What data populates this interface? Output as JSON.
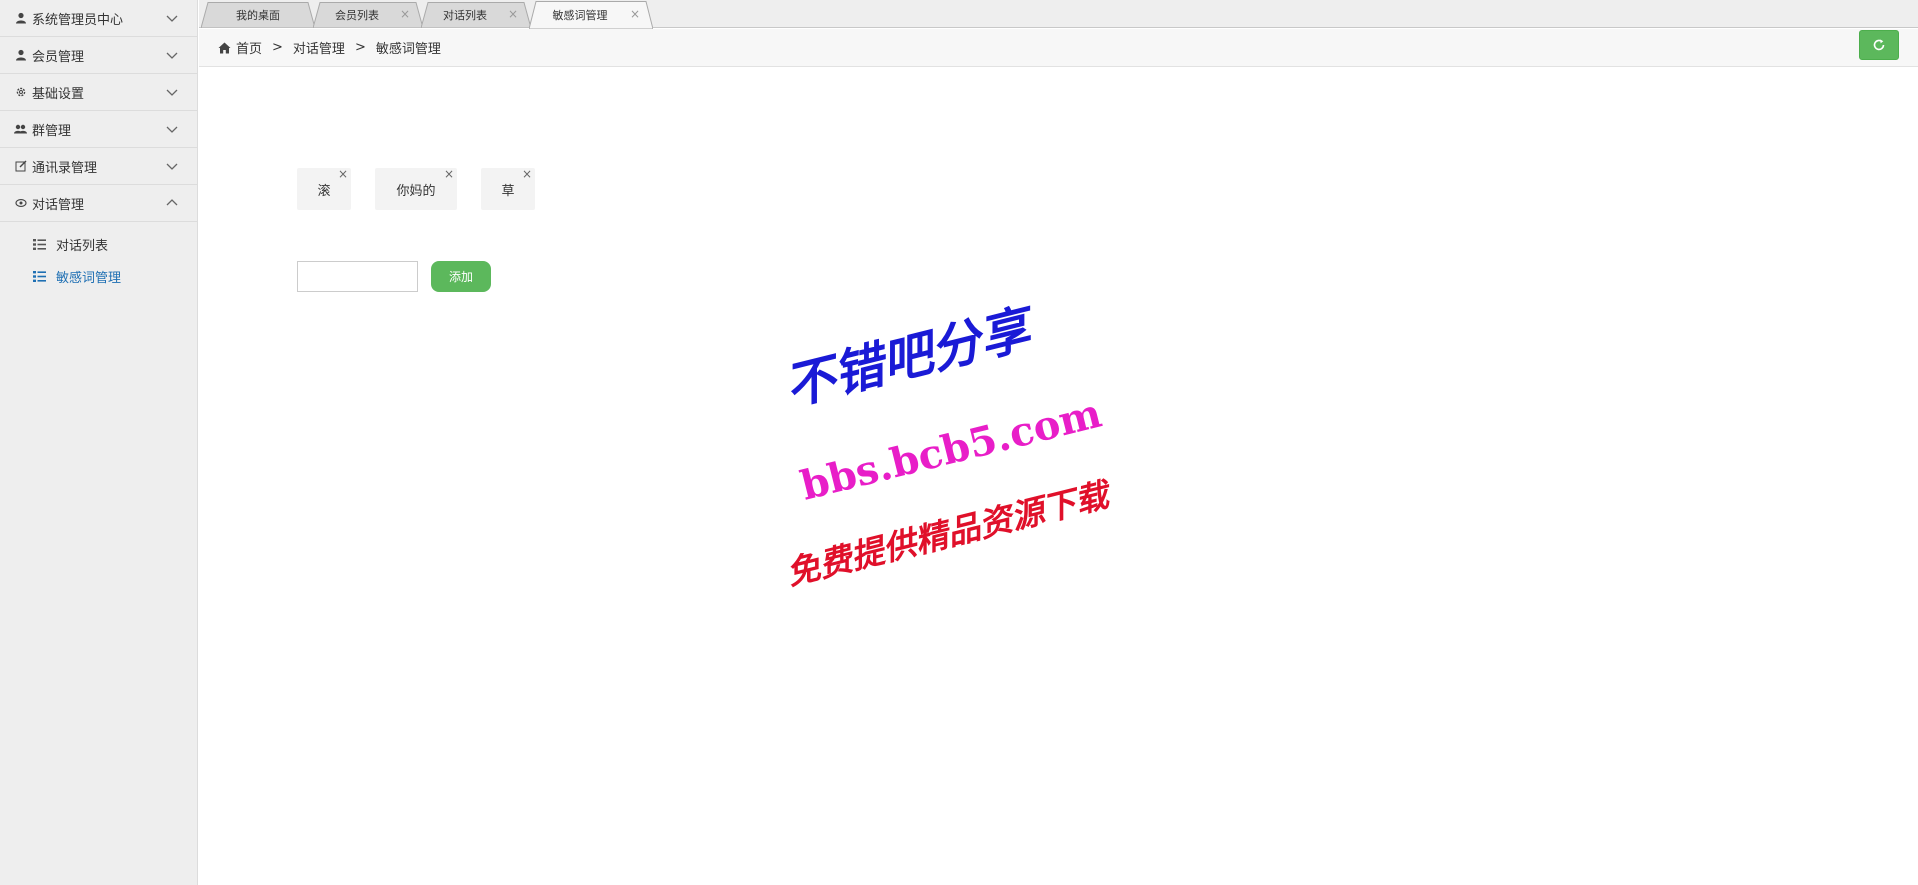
{
  "sidebar": {
    "items": [
      {
        "label": "系统管理员中心",
        "icon": "user-icon",
        "expanded": false
      },
      {
        "label": "会员管理",
        "icon": "user-icon",
        "expanded": false
      },
      {
        "label": "基础设置",
        "icon": "gear-icon",
        "expanded": false
      },
      {
        "label": "群管理",
        "icon": "users-icon",
        "expanded": false
      },
      {
        "label": "通讯录管理",
        "icon": "edit-icon",
        "expanded": false
      },
      {
        "label": "对话管理",
        "icon": "eye-icon",
        "expanded": true
      }
    ],
    "submenu": [
      {
        "label": "对话列表",
        "icon": "list-icon",
        "active": false
      },
      {
        "label": "敏感词管理",
        "icon": "list-icon",
        "active": true
      }
    ]
  },
  "tabs": [
    {
      "label": "我的桌面",
      "closable": false
    },
    {
      "label": "会员列表",
      "closable": true
    },
    {
      "label": "对话列表",
      "closable": true
    },
    {
      "label": "敏感词管理",
      "closable": true,
      "active": true
    }
  ],
  "tab_close_glyph": "×",
  "breadcrumb": {
    "items": [
      "首页",
      "对话管理",
      "敏感词管理"
    ],
    "separator": ">"
  },
  "sensitive_words": [
    "滚",
    "你妈的",
    "草"
  ],
  "word_input": {
    "value": "",
    "placeholder": ""
  },
  "add_button_label": "添加",
  "watermark": {
    "line1": "不错吧分享",
    "line2": "bbs.bcb5.com",
    "line3": "免费提供精品资源下载"
  },
  "colors": {
    "accent_green": "#5cb85c",
    "active_link": "#1e6fb3",
    "watermark_blue": "#1a1ad6",
    "watermark_magenta": "#e81ec8",
    "watermark_red": "#e0102a"
  }
}
